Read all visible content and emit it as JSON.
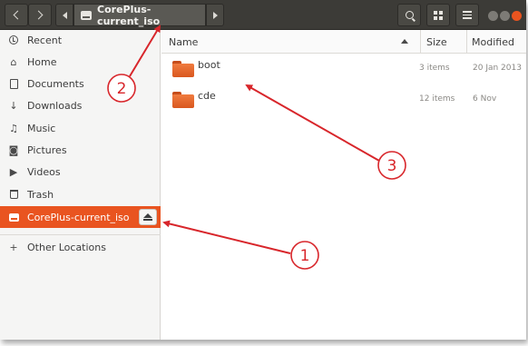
{
  "window": {
    "location": "CorePlus-current_iso"
  },
  "sidebar": {
    "items": [
      {
        "label": "Recent",
        "icon": "clock-icon"
      },
      {
        "label": "Home",
        "icon": "home-icon"
      },
      {
        "label": "Documents",
        "icon": "document-icon"
      },
      {
        "label": "Downloads",
        "icon": "download-icon"
      },
      {
        "label": "Music",
        "icon": "music-icon"
      },
      {
        "label": "Pictures",
        "icon": "camera-icon"
      },
      {
        "label": "Videos",
        "icon": "video-icon"
      },
      {
        "label": "Trash",
        "icon": "trash-icon"
      },
      {
        "label": "CorePlus-current_iso",
        "icon": "drive-icon"
      },
      {
        "label": "Other Locations",
        "icon": "plus-icon"
      }
    ]
  },
  "columns": {
    "name": "Name",
    "size": "Size",
    "modified": "Modified"
  },
  "files": [
    {
      "name": "boot",
      "size": "3 items",
      "modified": "20 Jan 2013"
    },
    {
      "name": "cde",
      "size": "12 items",
      "modified": "6 Nov"
    }
  ],
  "annotations": {
    "markers": [
      "1",
      "2",
      "3"
    ],
    "color": "#d8262b"
  },
  "colors": {
    "accent": "#e95420",
    "headerbar": "#3c3b37"
  }
}
